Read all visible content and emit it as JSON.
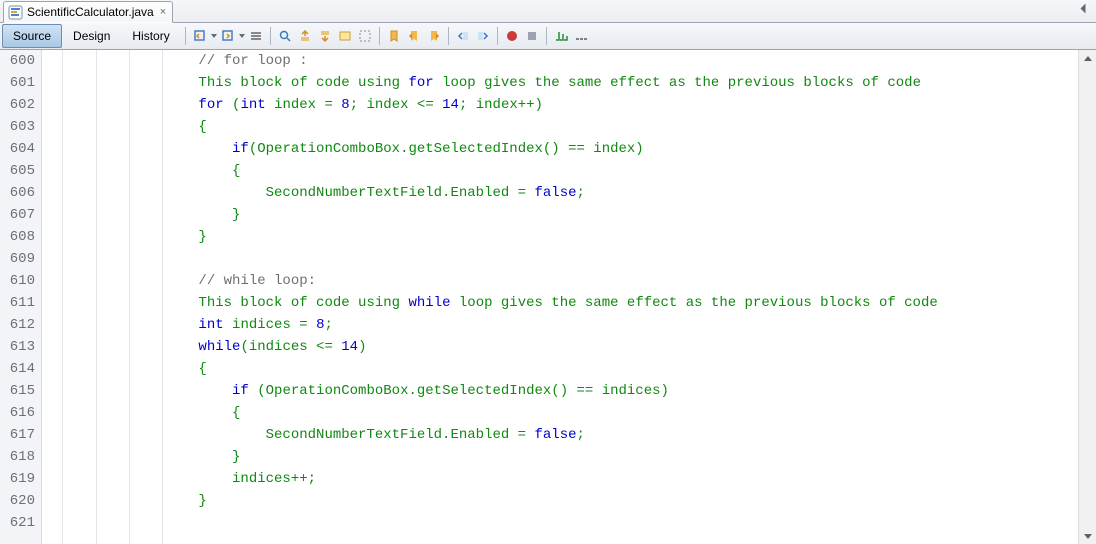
{
  "file_tab": {
    "filename": "ScientificCalculator.java"
  },
  "view_tabs": {
    "source": "Source",
    "design": "Design",
    "history": "History"
  },
  "toolbar": {
    "icons": [
      "last-edit-icon",
      "forward-edit-icon",
      "menu-drop-icon",
      "find-selection-icon",
      "find-prev-icon",
      "find-next-icon",
      "toggle-highlight-icon",
      "toggle-rect-icon",
      "toggle-bookmark-icon",
      "prev-bookmark-icon",
      "next-bookmark-icon",
      "shift-left-icon",
      "shift-right-icon",
      "start-macro-icon",
      "stop-macro-icon",
      "comment-icon",
      "uncomment-icon"
    ]
  },
  "editor": {
    "first_line": 600,
    "lines": [
      [
        [
          "comment",
          "                // for loop :"
        ]
      ],
      [
        [
          "green",
          "                This block of code using "
        ],
        [
          "blue",
          "for"
        ],
        [
          "green",
          " loop gives the same effect as the previous blocks of code"
        ]
      ],
      [
        [
          "green",
          "                "
        ],
        [
          "blue",
          "for"
        ],
        [
          "green",
          " ("
        ],
        [
          "blue",
          "int"
        ],
        [
          "green",
          " index = "
        ],
        [
          "num",
          "8"
        ],
        [
          "green",
          "; index <= "
        ],
        [
          "num",
          "14"
        ],
        [
          "green",
          "; index++)"
        ]
      ],
      [
        [
          "green",
          "                {"
        ]
      ],
      [
        [
          "green",
          "                    "
        ],
        [
          "blue",
          "if"
        ],
        [
          "green",
          "(OperationComboBox.getSelectedIndex() == index)"
        ]
      ],
      [
        [
          "green",
          "                    {"
        ]
      ],
      [
        [
          "green",
          "                        SecondNumberTextField.Enabled = "
        ],
        [
          "bool",
          "false"
        ],
        [
          "green",
          ";"
        ]
      ],
      [
        [
          "green",
          "                    }"
        ]
      ],
      [
        [
          "green",
          "                }"
        ]
      ],
      [
        [
          "black",
          ""
        ]
      ],
      [
        [
          "green",
          "                "
        ],
        [
          "comment",
          "// while loop:"
        ]
      ],
      [
        [
          "green",
          "                This block of code using "
        ],
        [
          "blue",
          "while"
        ],
        [
          "green",
          " loop gives the same effect as the previous blocks of code"
        ]
      ],
      [
        [
          "green",
          "                "
        ],
        [
          "blue",
          "int"
        ],
        [
          "green",
          " indices = "
        ],
        [
          "num",
          "8"
        ],
        [
          "green",
          ";"
        ]
      ],
      [
        [
          "green",
          "                "
        ],
        [
          "blue",
          "while"
        ],
        [
          "green",
          "(indices <= "
        ],
        [
          "num",
          "14"
        ],
        [
          "green",
          ")"
        ]
      ],
      [
        [
          "green",
          "                {"
        ]
      ],
      [
        [
          "green",
          "                    "
        ],
        [
          "blue",
          "if"
        ],
        [
          "green",
          " (OperationComboBox.getSelectedIndex() == indices)"
        ]
      ],
      [
        [
          "green",
          "                    {"
        ]
      ],
      [
        [
          "green",
          "                        SecondNumberTextField.Enabled = "
        ],
        [
          "bool",
          "false"
        ],
        [
          "green",
          ";"
        ]
      ],
      [
        [
          "green",
          "                    }"
        ]
      ],
      [
        [
          "green",
          "                    indices++;"
        ]
      ],
      [
        [
          "green",
          "                }"
        ]
      ],
      [
        [
          "black",
          ""
        ]
      ]
    ]
  }
}
